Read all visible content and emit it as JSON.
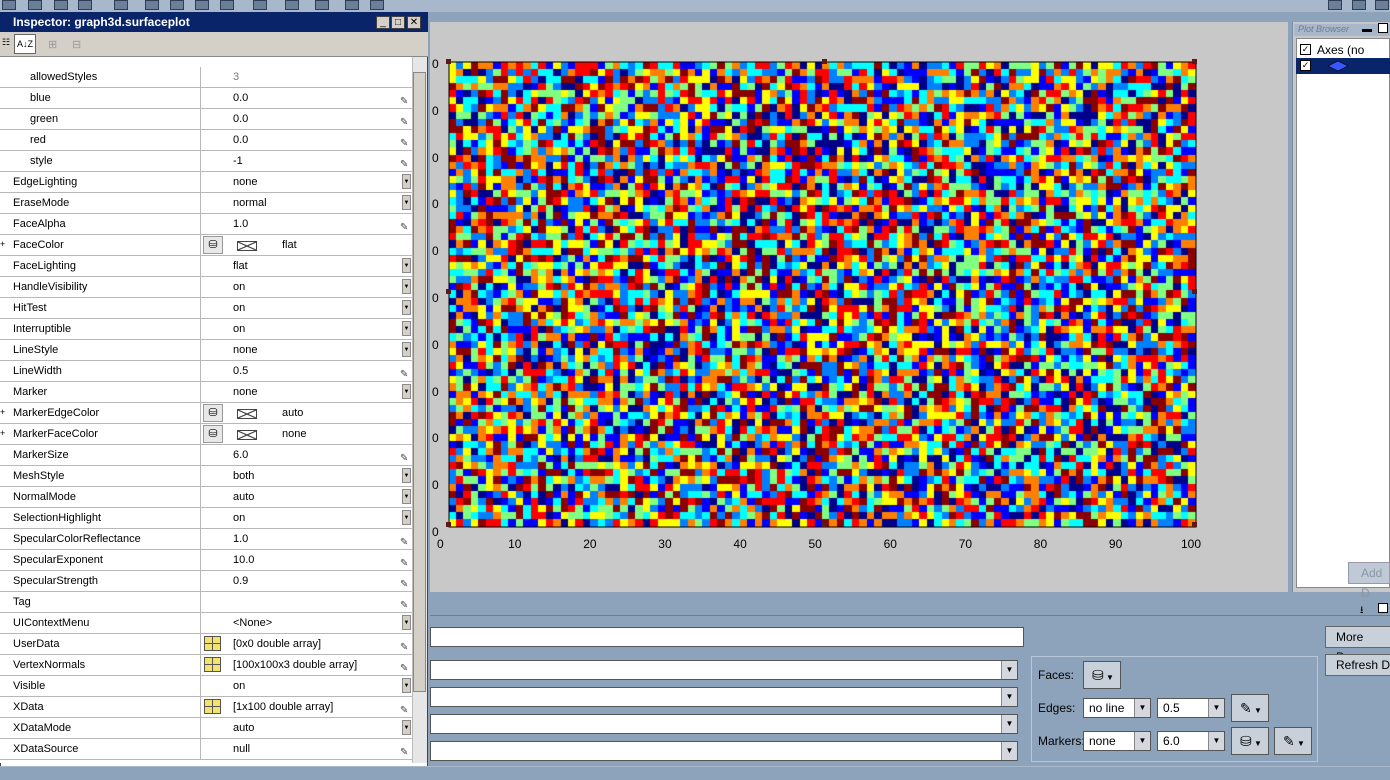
{
  "inspector": {
    "title": "Inspector:  graph3d.surfaceplot",
    "sort_icon_label": "A↓Z",
    "rows": [
      {
        "name": "allowedStyles",
        "value": "3",
        "sub": true,
        "ctrl": "none",
        "grey": true
      },
      {
        "name": "blue",
        "value": "0.0",
        "sub": true,
        "ctrl": "pencil"
      },
      {
        "name": "green",
        "value": "0.0",
        "sub": true,
        "ctrl": "pencil"
      },
      {
        "name": "red",
        "value": "0.0",
        "sub": true,
        "ctrl": "pencil"
      },
      {
        "name": "style",
        "value": "-1",
        "sub": true,
        "ctrl": "pencil"
      },
      {
        "name": "EdgeLighting",
        "value": "none",
        "ctrl": "dropdown"
      },
      {
        "name": "EraseMode",
        "value": "normal",
        "ctrl": "dropdown"
      },
      {
        "name": "FaceAlpha",
        "value": "1.0",
        "ctrl": "pencil"
      },
      {
        "name": "FaceColor",
        "value": "flat",
        "ctrl": "color",
        "expand": true
      },
      {
        "name": "FaceLighting",
        "value": "flat",
        "ctrl": "dropdown"
      },
      {
        "name": "HandleVisibility",
        "value": "on",
        "ctrl": "dropdown"
      },
      {
        "name": "HitTest",
        "value": "on",
        "ctrl": "dropdown"
      },
      {
        "name": "Interruptible",
        "value": "on",
        "ctrl": "dropdown"
      },
      {
        "name": "LineStyle",
        "value": "none",
        "ctrl": "dropdown"
      },
      {
        "name": "LineWidth",
        "value": "0.5",
        "ctrl": "pencil"
      },
      {
        "name": "Marker",
        "value": "none",
        "ctrl": "dropdown"
      },
      {
        "name": "MarkerEdgeColor",
        "value": "auto",
        "ctrl": "color",
        "expand": true
      },
      {
        "name": "MarkerFaceColor",
        "value": "none",
        "ctrl": "color",
        "expand": true
      },
      {
        "name": "MarkerSize",
        "value": "6.0",
        "ctrl": "pencil"
      },
      {
        "name": "MeshStyle",
        "value": "both",
        "ctrl": "dropdown"
      },
      {
        "name": "NormalMode",
        "value": "auto",
        "ctrl": "dropdown"
      },
      {
        "name": "SelectionHighlight",
        "value": "on",
        "ctrl": "dropdown"
      },
      {
        "name": "SpecularColorReflectance",
        "value": "1.0",
        "ctrl": "pencil"
      },
      {
        "name": "SpecularExponent",
        "value": "10.0",
        "ctrl": "pencil"
      },
      {
        "name": "SpecularStrength",
        "value": "0.9",
        "ctrl": "pencil"
      },
      {
        "name": "Tag",
        "value": "",
        "ctrl": "pencil"
      },
      {
        "name": "UIContextMenu",
        "value": "<None>",
        "ctrl": "dropdown"
      },
      {
        "name": "UserData",
        "value": "[0x0  double array]",
        "ctrl": "array"
      },
      {
        "name": "VertexNormals",
        "value": "[100x100x3  double array]",
        "ctrl": "array"
      },
      {
        "name": "Visible",
        "value": "on",
        "ctrl": "dropdown"
      },
      {
        "name": "XData",
        "value": "[1x100  double array]",
        "ctrl": "array"
      },
      {
        "name": "XDataMode",
        "value": "auto",
        "ctrl": "dropdown"
      },
      {
        "name": "XDataSource",
        "value": "null",
        "ctrl": "pencil"
      }
    ]
  },
  "plot": {
    "x_ticks": [
      "0",
      "10",
      "20",
      "30",
      "40",
      "50",
      "60",
      "70",
      "80",
      "90",
      "100"
    ],
    "y_ticks": [
      "0",
      "0",
      "0",
      "0",
      "0",
      "0",
      "0",
      "0",
      "0",
      "0",
      "0"
    ],
    "colormap": [
      "#00008b",
      "#0000ff",
      "#0080ff",
      "#00ffff",
      "#80ff80",
      "#ffff00",
      "#ff8000",
      "#ff0000",
      "#8b0000"
    ]
  },
  "plot_browser": {
    "title": "Plot Browser",
    "axes_item": "Axes (no title)",
    "axes_checked": "✓",
    "surface_checked": "✓",
    "add_data_label": "Add D"
  },
  "property_editor": {
    "faces_label": "Faces:",
    "edges_label": "Edges:",
    "markers_label": "Markers:",
    "edge_line": "no line",
    "edge_width": "0.5",
    "marker_type": "none",
    "marker_size": "6.0",
    "more_props_label": "More Prope",
    "refresh_label": "Refresh D"
  }
}
